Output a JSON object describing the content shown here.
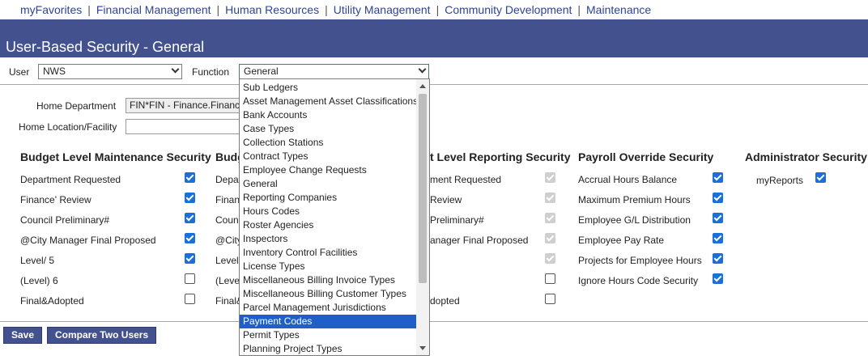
{
  "nav": {
    "items": [
      "myFavorites",
      "Financial Management",
      "Human Resources",
      "Utility Management",
      "Community Development",
      "Maintenance"
    ],
    "separator": "|"
  },
  "header": {
    "title": "User-Based Security - General"
  },
  "filters": {
    "user_label": "User",
    "user_value": "NWS",
    "function_label": "Function",
    "function_value": "General"
  },
  "form": {
    "home_department_label": "Home Department",
    "home_department_value": "FIN*FIN - Finance.Financia",
    "home_location_label": "Home Location/Facility",
    "home_location_value": ""
  },
  "sections": {
    "budget_maintenance": {
      "title": "Budget Level Maintenance Security",
      "rows": [
        {
          "label": "Department Requested",
          "checked": true
        },
        {
          "label": "Finance' Review",
          "checked": true
        },
        {
          "label": "Council Preliminary#",
          "checked": true
        },
        {
          "label": "@City Manager Final Proposed",
          "checked": true
        },
        {
          "label": "Level/ 5",
          "checked": true
        },
        {
          "label": "(Level) 6",
          "checked": false
        },
        {
          "label": "Final&Adopted",
          "checked": false
        }
      ]
    },
    "budget_col2": {
      "title": "Budg",
      "rows": [
        "Depa",
        "Finan",
        "Counc",
        "@City",
        "Level",
        "(Leve",
        "Final&"
      ]
    },
    "budget_reporting": {
      "title": "t Level Reporting Security",
      "rows": [
        {
          "label": "ment Requested",
          "state": "disabled"
        },
        {
          "label": "Review",
          "state": "disabled"
        },
        {
          "label": "Preliminary#",
          "state": "disabled"
        },
        {
          "label": "anager Final Proposed",
          "state": "disabled"
        },
        {
          "label": "",
          "state": "disabled"
        },
        {
          "label": "",
          "state": "off"
        },
        {
          "label": "dopted",
          "state": "off"
        }
      ]
    },
    "payroll_override": {
      "title": "Payroll Override Security",
      "rows": [
        {
          "label": "Accrual Hours Balance",
          "checked": true
        },
        {
          "label": "Maximum Premium Hours",
          "checked": true
        },
        {
          "label": "Employee G/L Distribution",
          "checked": true
        },
        {
          "label": "Employee Pay Rate",
          "checked": true
        },
        {
          "label": "Projects for Employee Hours",
          "checked": true
        },
        {
          "label": "Ignore Hours Code Security",
          "checked": true
        }
      ]
    },
    "administrator": {
      "title": "Administrator Security",
      "rows": [
        {
          "label": "myReports",
          "checked": true
        }
      ]
    }
  },
  "buttons": {
    "save": "Save",
    "compare": "Compare Two Users"
  },
  "function_dropdown": {
    "highlighted_index": 17,
    "options": [
      "Sub Ledgers",
      "Asset Management Asset Classifications",
      "Bank Accounts",
      "Case Types",
      "Collection Stations",
      "Contract Types",
      "Employee Change Requests",
      "General",
      "Reporting Companies",
      "Hours Codes",
      "Roster Agencies",
      "Inspectors",
      "Inventory Control Facilities",
      "License Types",
      "Miscellaneous Billing Invoice Types",
      "Miscellaneous Billing Customer Types",
      "Parcel Management Jurisdictions",
      "Payment Codes",
      "Permit Types",
      "Planning Project Types"
    ]
  },
  "colors": {
    "header_bg": "#43528f",
    "nav_link": "#2d4496",
    "checkbox_on": "#1a6fd8",
    "highlight": "#1e5fc8"
  }
}
